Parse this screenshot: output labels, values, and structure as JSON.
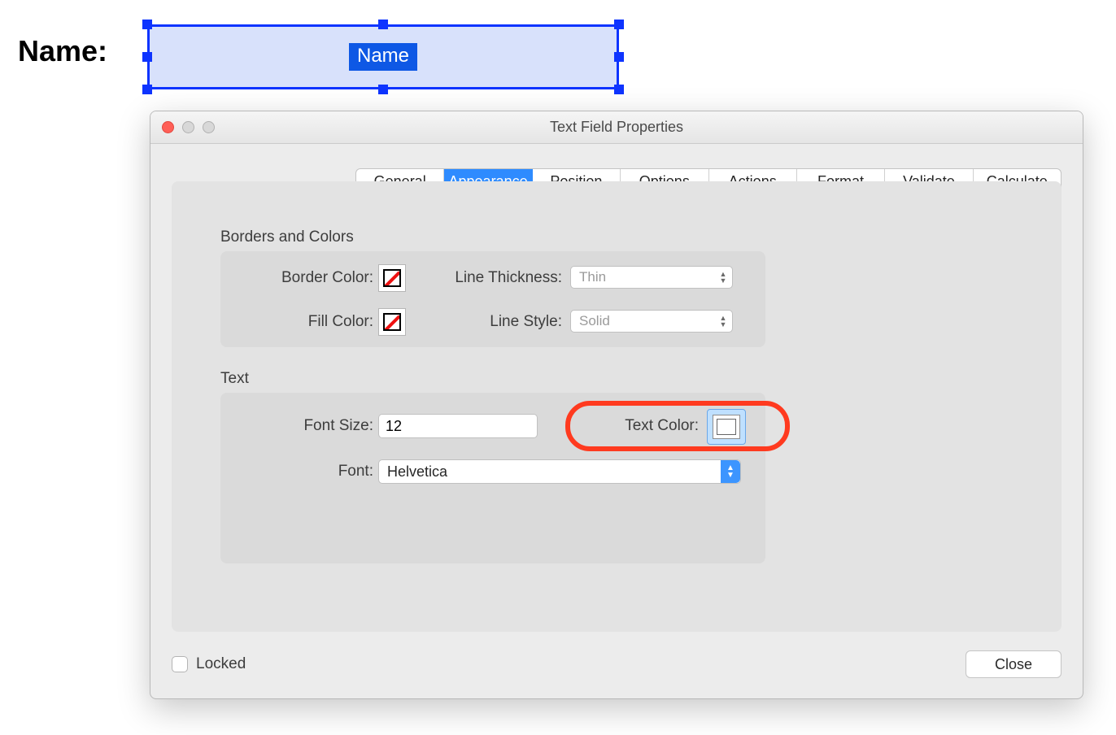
{
  "doc": {
    "name_label": "Name:",
    "field_chip": "Name"
  },
  "dialog": {
    "title": "Text Field Properties",
    "tabs": {
      "general": "General",
      "appearance": "Appearance",
      "position": "Position",
      "options": "Options",
      "actions": "Actions",
      "format": "Format",
      "validate": "Validate",
      "calculate": "Calculate",
      "active": "appearance"
    },
    "sections": {
      "borders_title": "Borders and Colors",
      "text_title": "Text"
    },
    "borders": {
      "border_color_label": "Border Color:",
      "fill_color_label": "Fill Color:",
      "line_thickness_label": "Line Thickness:",
      "line_style_label": "Line Style:",
      "line_thickness_value": "Thin",
      "line_style_value": "Solid",
      "border_color_value": "none",
      "fill_color_value": "none"
    },
    "text": {
      "font_size_label": "Font Size:",
      "font_size_value": "12",
      "font_label": "Font:",
      "font_value": "Helvetica",
      "text_color_label": "Text Color:",
      "text_color_value": "#ffffff"
    },
    "locked_label": "Locked",
    "locked_checked": false,
    "close_label": "Close"
  }
}
